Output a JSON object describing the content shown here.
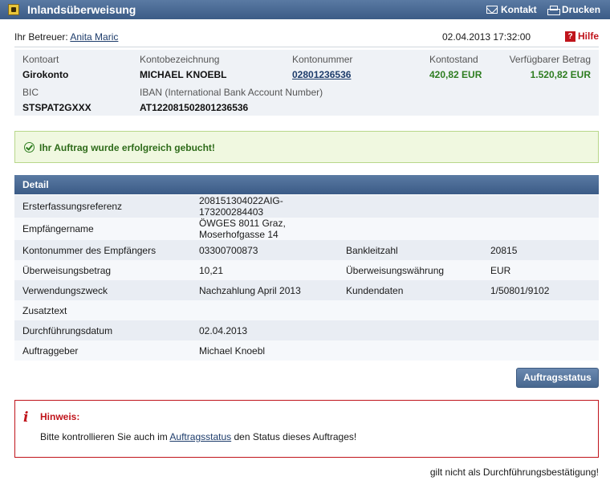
{
  "window": {
    "title": "Inlandsüberweisung",
    "kontakt": "Kontakt",
    "drucken": "Drucken"
  },
  "header": {
    "betreuer_label": "Ihr Betreuer:",
    "betreuer_name": "Anita Maric",
    "datetime": "02.04.2013 17:32:00",
    "hilfe": "Hilfe"
  },
  "account": {
    "kontoart_label": "Kontoart",
    "kontoart": "Girokonto",
    "bezeichnung_label": "Kontobezeichnung",
    "bezeichnung": "MICHAEL KNOEBL",
    "kontonummer_label": "Kontonummer",
    "kontonummer": "02801236536",
    "kontostand_label": "Kontostand",
    "kontostand": "420,82 EUR",
    "verfuegbar_label": "Verfügbarer Betrag",
    "verfuegbar": "1.520,82 EUR",
    "bic_label": "BIC",
    "bic": "STSPAT2GXXX",
    "iban_label": "IBAN (International Bank Account Number)",
    "iban": "AT122081502801236536"
  },
  "success": {
    "message": "Ihr Auftrag wurde erfolgreich gebucht!"
  },
  "detail": {
    "heading": "Detail",
    "rows": [
      {
        "l1": "Ersterfassungsreferenz",
        "v1": "208151304022AIG-173200284403",
        "l2": "",
        "v2": ""
      },
      {
        "l1": "Empfängername",
        "v1": "ÖWGES 8011 Graz, Moserhofgasse 14",
        "l2": "",
        "v2": ""
      },
      {
        "l1": "Kontonummer des Empfängers",
        "v1": "03300700873",
        "l2": "Bankleitzahl",
        "v2": "20815"
      },
      {
        "l1": "Überweisungsbetrag",
        "v1": "10,21",
        "l2": "Überweisungswährung",
        "v2": "EUR"
      },
      {
        "l1": "Verwendungszweck",
        "v1": "Nachzahlung April 2013",
        "l2": "Kundendaten",
        "v2": "1/50801/9102"
      },
      {
        "l1": "Zusatztext",
        "v1": "",
        "l2": "",
        "v2": ""
      },
      {
        "l1": "Durchführungsdatum",
        "v1": "02.04.2013",
        "l2": "",
        "v2": ""
      },
      {
        "l1": "Auftraggeber",
        "v1": "Michael Knoebl",
        "l2": "",
        "v2": ""
      }
    ]
  },
  "actions": {
    "auftragsstatus": "Auftragsstatus"
  },
  "notice": {
    "title": "Hinweis:",
    "text_before": "Bitte kontrollieren Sie auch im ",
    "link": "Auftragsstatus",
    "text_after": " den Status dieses Auftrages!"
  },
  "footer": {
    "note": "gilt nicht als Durchführungsbestätigung!"
  }
}
